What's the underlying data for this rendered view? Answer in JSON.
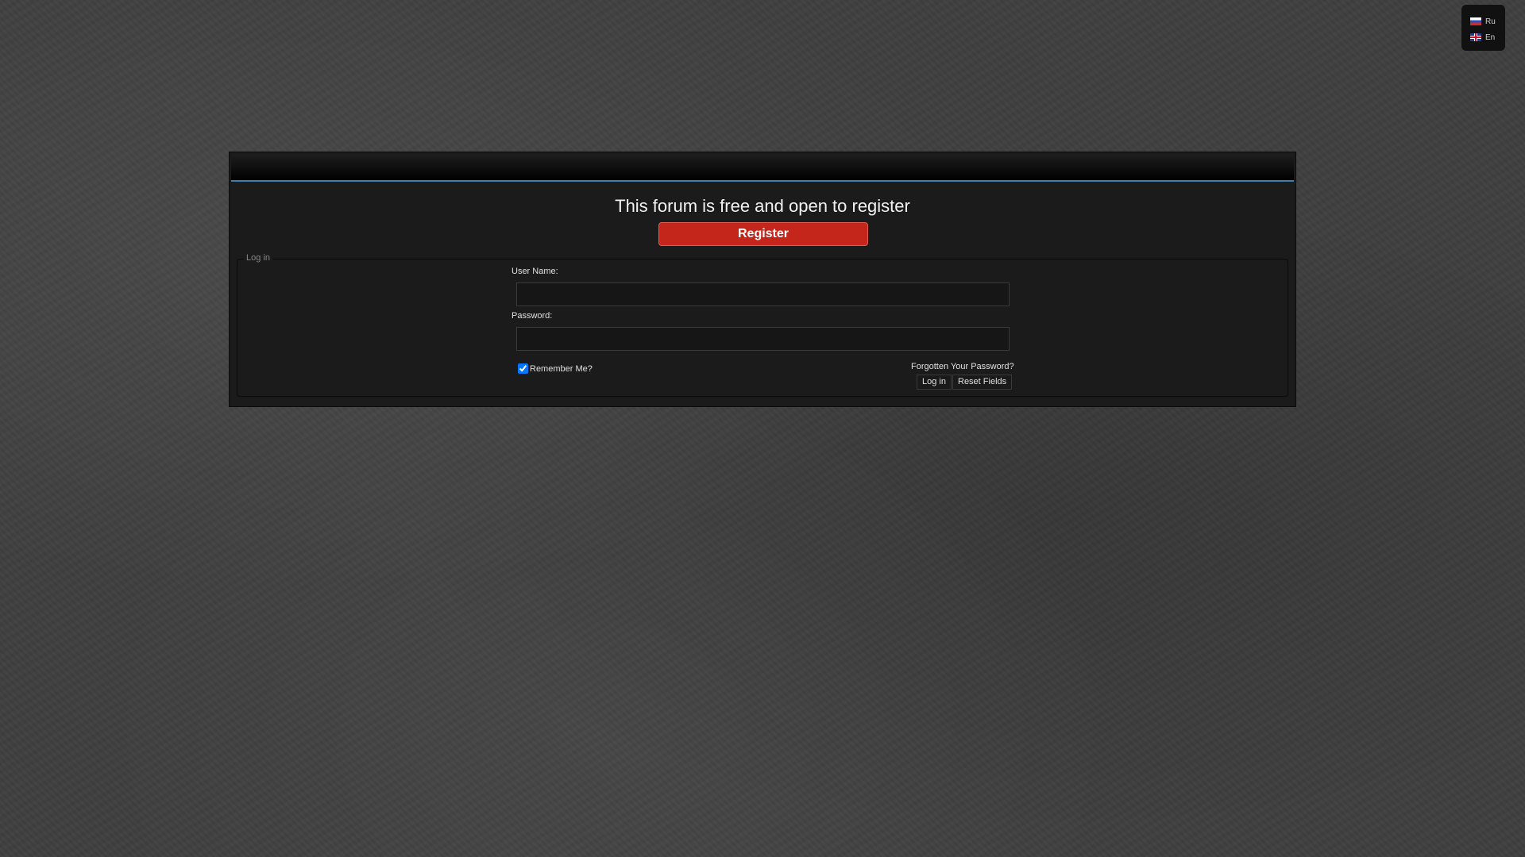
{
  "language_switcher": {
    "items": [
      {
        "label": "Ru"
      },
      {
        "label": "En"
      }
    ]
  },
  "main": {
    "headline": "This forum is free and open to register",
    "register_label": "Register"
  },
  "login": {
    "legend": "Log in",
    "username_label": "User Name:",
    "username_value": "",
    "password_label": "Password:",
    "password_value": "",
    "remember_label": "Remember Me?",
    "remember_checked": true,
    "forgot_label": "Forgotten Your Password?",
    "login_button": "Log in",
    "reset_button": "Reset Fields"
  },
  "colors": {
    "accent_blue": "#3b7fb0",
    "register_red": "#c4261b"
  }
}
